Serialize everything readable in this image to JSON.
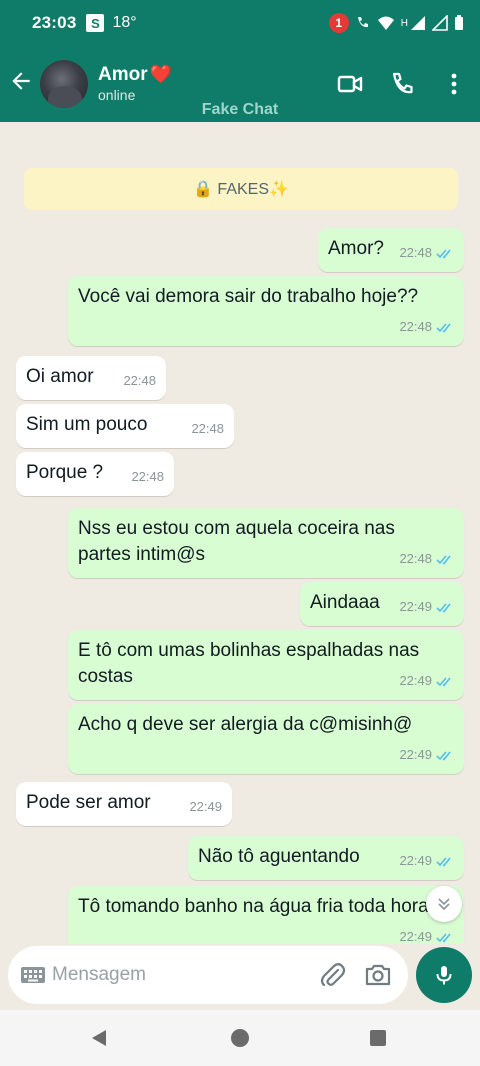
{
  "status_bar": {
    "time": "23:03",
    "s_icon": "S",
    "temperature": "18°",
    "notification_count": "1"
  },
  "header": {
    "contact_name": "Amor",
    "heart": "❤️",
    "status": "online",
    "watermark": "Fake Chat"
  },
  "banner": {
    "text": "🔒 FAKES✨"
  },
  "messages": [
    {
      "dir": "out",
      "text": "Amor?",
      "time": "22:48"
    },
    {
      "dir": "out",
      "text": "Você vai demora sair do trabalho hoje??",
      "time": "22:48"
    },
    {
      "dir": "in",
      "text": "Oi amor",
      "time": "22:48"
    },
    {
      "dir": "in",
      "text": "Sim um pouco",
      "time": "22:48"
    },
    {
      "dir": "in",
      "text": "Porque ?",
      "time": "22:48"
    },
    {
      "dir": "out",
      "text": "Nss eu estou com aquela coceira nas partes intim@s",
      "time": "22:48"
    },
    {
      "dir": "out",
      "text": "Aindaaa",
      "time": "22:49"
    },
    {
      "dir": "out",
      "text": "E tô com umas bolinhas espalhadas nas costas",
      "time": "22:49"
    },
    {
      "dir": "out",
      "text": "Acho q deve ser alergia da c@misinh@",
      "time": "22:49"
    },
    {
      "dir": "in",
      "text": "Pode ser amor",
      "time": "22:49"
    },
    {
      "dir": "out",
      "text": "Não tô aguentando",
      "time": "22:49"
    },
    {
      "dir": "out",
      "text": "Tô tomando banho na água fria toda hora",
      "time": "22:49"
    }
  ],
  "input": {
    "placeholder": "Mensagem"
  },
  "colors": {
    "header": "#0f7b69",
    "outgoing": "#d9fdd3",
    "incoming": "#ffffff",
    "chat_bg": "#efeae2",
    "read_ticks": "#53bdeb"
  }
}
